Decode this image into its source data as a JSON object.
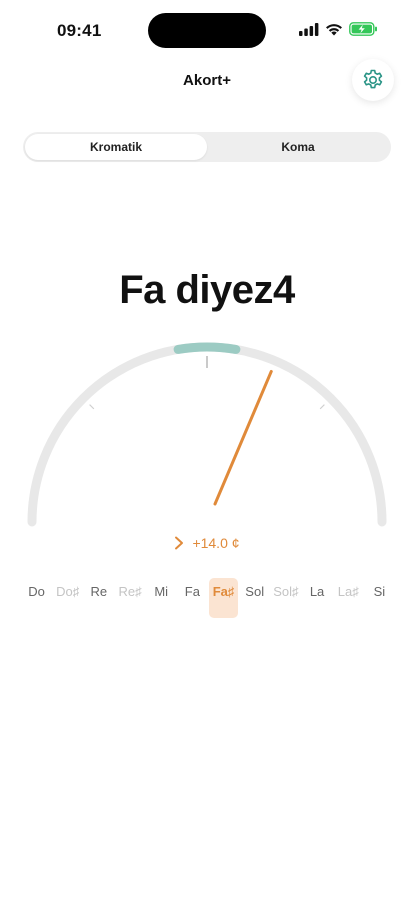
{
  "status_bar": {
    "time": "09:41"
  },
  "header": {
    "title": "Akort+"
  },
  "segments": [
    {
      "label": "Kromatik",
      "active": true
    },
    {
      "label": "Koma",
      "active": false
    }
  ],
  "tuner": {
    "note": "Fa diyez4",
    "cents_text": "+14.0 ¢",
    "cents_value": 14.0,
    "direction_icon": "chevron-right-icon"
  },
  "notes": [
    {
      "label": "Do",
      "kind": "natural"
    },
    {
      "label": "Do♯",
      "kind": "sharp"
    },
    {
      "label": "Re",
      "kind": "natural"
    },
    {
      "label": "Re♯",
      "kind": "sharp"
    },
    {
      "label": "Mi",
      "kind": "natural"
    },
    {
      "label": "Fa",
      "kind": "natural"
    },
    {
      "label": "Fa♯",
      "kind": "active"
    },
    {
      "label": "Sol",
      "kind": "natural"
    },
    {
      "label": "Sol♯",
      "kind": "sharp"
    },
    {
      "label": "La",
      "kind": "natural"
    },
    {
      "label": "La♯",
      "kind": "sharp"
    },
    {
      "label": "Si",
      "kind": "natural"
    }
  ],
  "colors": {
    "accent": "#e08a3a",
    "in_tune_zone": "#9ccbc3",
    "settings_icon": "#2a9486",
    "track": "#e8e8e8",
    "battery": "#34c759"
  }
}
